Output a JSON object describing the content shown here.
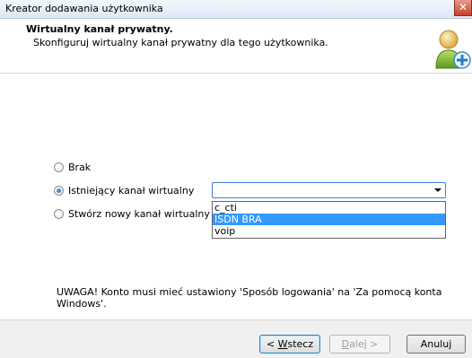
{
  "window": {
    "title": "Kreator dodawania użytkownika",
    "close_glyph": "✕"
  },
  "header": {
    "title": "Wirtualny kanał prywatny.",
    "subtitle": "Skonfiguruj wirtualny kanał prywatny dla tego użytkownika.",
    "icon": "user-add-icon"
  },
  "options": [
    {
      "label": "Brak",
      "checked": false
    },
    {
      "label": "Istniejący kanał wirtualny",
      "checked": true
    },
    {
      "label": "Stwórz nowy kanał wirtualny",
      "checked": false
    }
  ],
  "select": {
    "value": "",
    "items": [
      "c_cti",
      "ISDN BRA",
      "voip"
    ],
    "highlighted_index": 1
  },
  "warning": "UWAGA! Konto musi mieć ustawiony 'Sposób logowania' na 'Za pomocą konta Windows'.",
  "buttons": {
    "back_prefix": "< ",
    "back_key": "W",
    "back_rest": "stecz",
    "next_key": "D",
    "next_rest": "alej >",
    "cancel": "Anuluj"
  },
  "colors": {
    "accent": "#3399ff",
    "close": "#c8402a"
  }
}
